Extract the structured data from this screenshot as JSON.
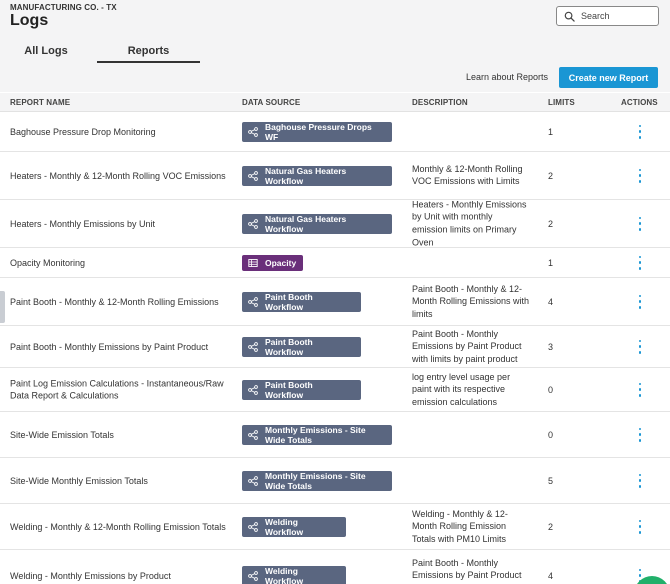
{
  "header": {
    "company": "MANUFACTURING CO. - TX",
    "title": "Logs",
    "search_placeholder": "Search"
  },
  "tabs": [
    {
      "label": "All Logs",
      "active": false
    },
    {
      "label": "Reports",
      "active": true
    }
  ],
  "toolbar": {
    "learn_label": "Learn about Reports",
    "create_label": "Create new Report"
  },
  "table": {
    "columns": [
      "REPORT NAME",
      "DATA SOURCE",
      "DESCRIPTION",
      "LIMITS",
      "ACTIONS"
    ],
    "rows": [
      {
        "name": "Baghouse Pressure Drop Monitoring",
        "source": "Baghouse Pressure Drops WF",
        "source_type": "workflow",
        "description": "",
        "limits": "1"
      },
      {
        "name": "Heaters - Monthly & 12-Month Rolling VOC Emissions",
        "source": "Natural Gas Heaters Workflow",
        "source_type": "workflow",
        "description": "Monthly & 12-Month Rolling VOC Emissions with Limits",
        "limits": "2"
      },
      {
        "name": "Heaters - Monthly Emissions by Unit",
        "source": "Natural Gas Heaters Workflow",
        "source_type": "workflow",
        "description": "Heaters - Monthly Emissions by Unit with monthly emission limits on Primary Oven",
        "limits": "2"
      },
      {
        "name": "Opacity Monitoring",
        "source": "Opacity",
        "source_type": "table",
        "description": "",
        "limits": "1"
      },
      {
        "name": "Paint Booth - Monthly & 12-Month Rolling Emissions",
        "source": "Paint Booth Workflow",
        "source_type": "workflow",
        "description": "Paint Booth - Monthly & 12-Month Rolling Emissions with limits",
        "limits": "4"
      },
      {
        "name": "Paint Booth - Monthly Emissions by Paint Product",
        "source": "Paint Booth Workflow",
        "source_type": "workflow",
        "description": "Paint Booth - Monthly Emissions by Paint Product with limits by paint product",
        "limits": "3"
      },
      {
        "name": "Paint Log Emission Calculations - Instantaneous/Raw Data Report & Calculations",
        "source": "Paint Booth Workflow",
        "source_type": "workflow",
        "description": "log entry level usage per paint with its respective emission calculations",
        "limits": "0"
      },
      {
        "name": "Site-Wide Emission Totals",
        "source": "Monthly Emissions - Site Wide Totals",
        "source_type": "workflow",
        "description": "",
        "limits": "0"
      },
      {
        "name": "Site-Wide Monthly Emission Totals",
        "source": "Monthly Emissions - Site Wide Totals",
        "source_type": "workflow",
        "description": "",
        "limits": "5"
      },
      {
        "name": "Welding - Monthly & 12-Month Rolling Emission Totals",
        "source": "Welding Workflow",
        "source_type": "workflow",
        "description": "Welding - Monthly & 12-Month Rolling Emission Totals with PM10 Limits",
        "limits": "2"
      },
      {
        "name": "Welding - Monthly Emissions by Product",
        "source": "Welding Workflow",
        "source_type": "workflow",
        "description": "Paint Booth - Monthly Emissions by Paint Product with limits by welding product",
        "limits": "4"
      }
    ]
  },
  "colors": {
    "accent": "#1a96d4",
    "workflow_pill": "#5a6680",
    "table_pill": "#6a2f7a",
    "header_bg": "#f4f4f5"
  },
  "icons": {
    "search": "search-icon",
    "workflow": "workflow-icon",
    "table": "table-icon",
    "actions": "kebab-menu-icon"
  }
}
